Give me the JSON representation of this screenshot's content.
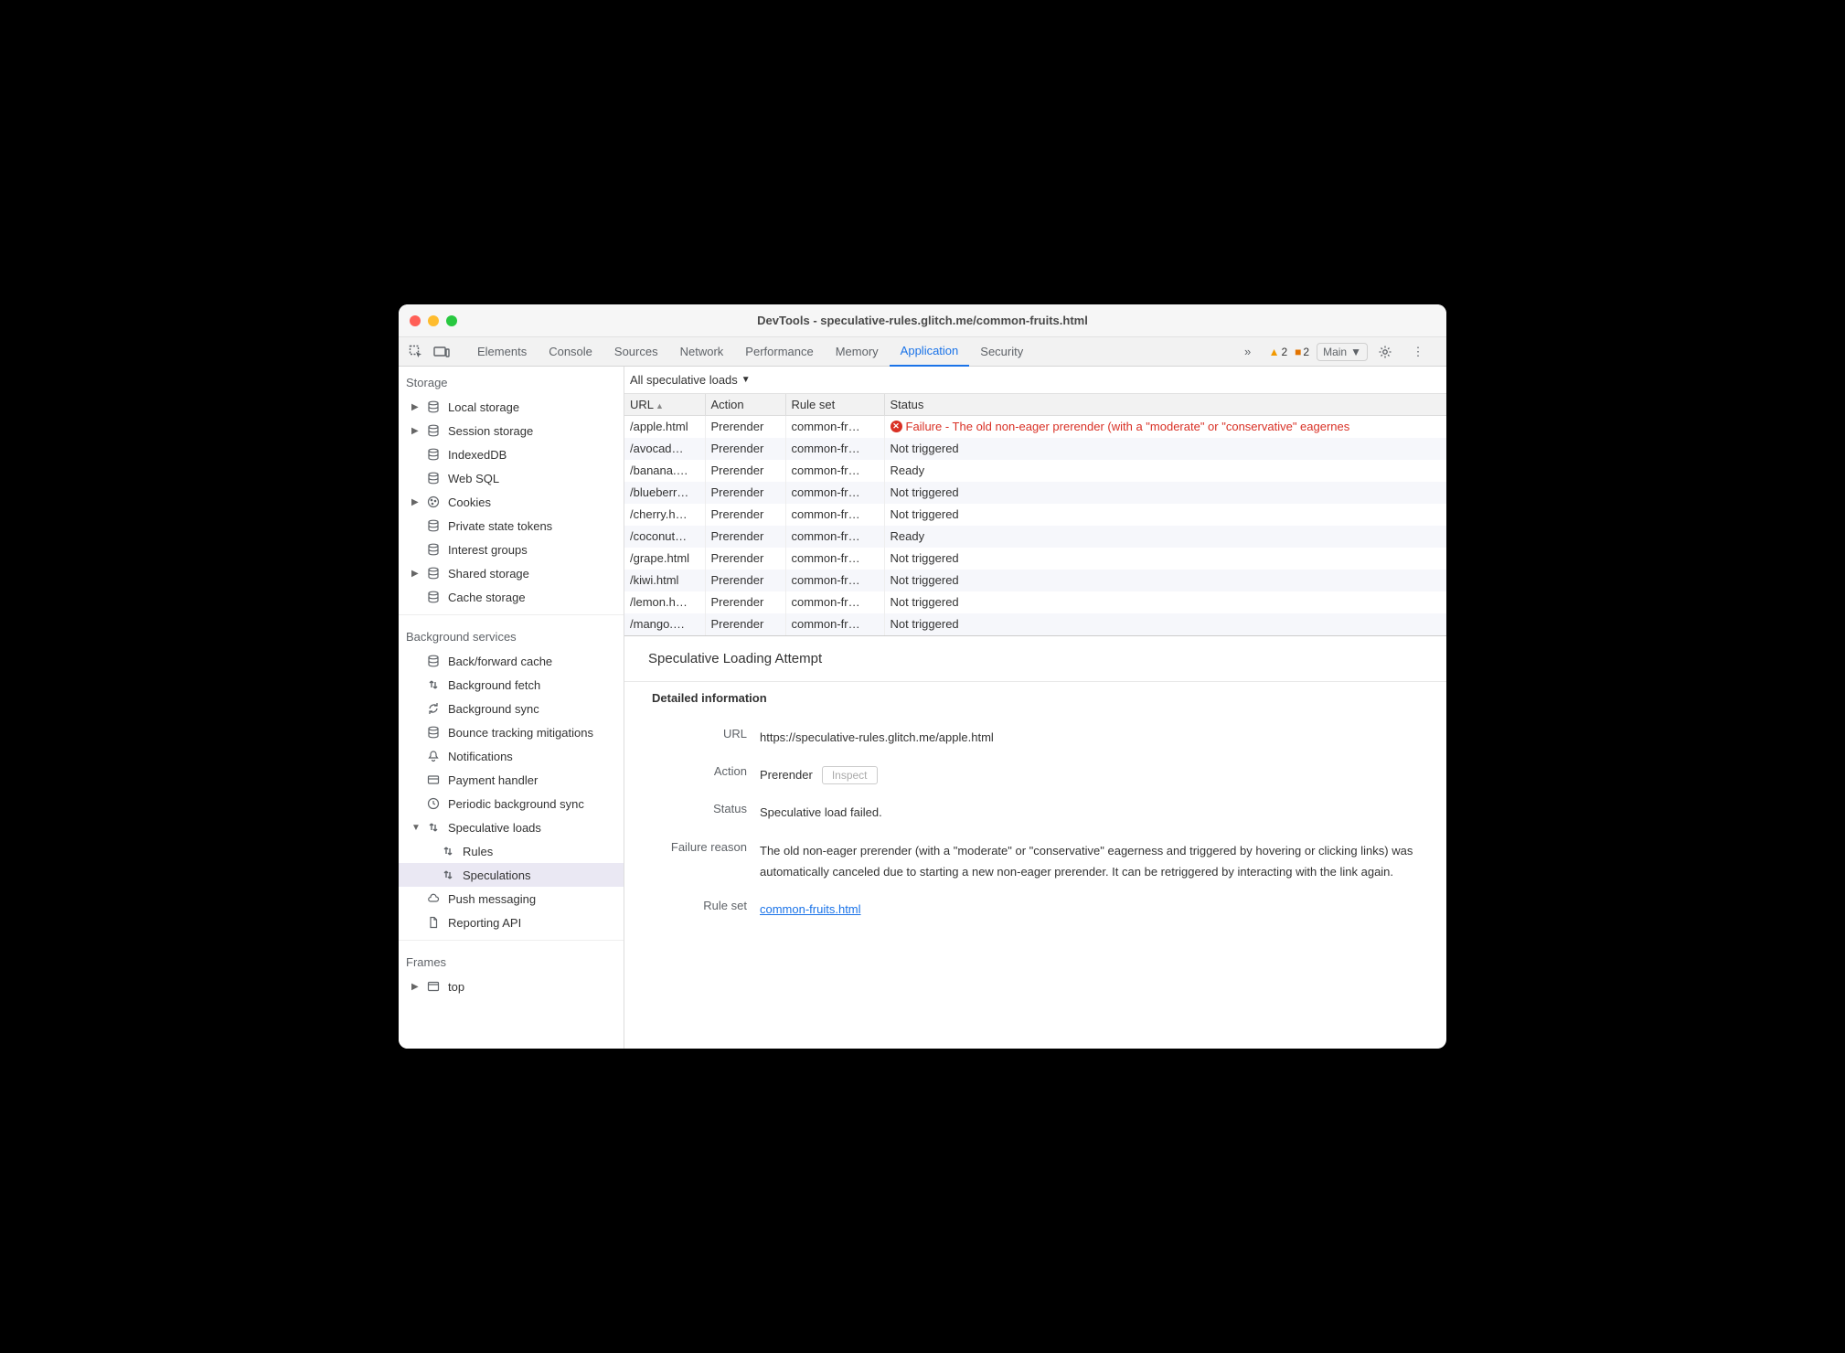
{
  "window": {
    "title": "DevTools - speculative-rules.glitch.me/common-fruits.html"
  },
  "tabs": [
    "Elements",
    "Console",
    "Sources",
    "Network",
    "Performance",
    "Memory",
    "Application",
    "Security"
  ],
  "active_tab": "Application",
  "overflow_indicator": "»",
  "warnings_count": "2",
  "errors_count": "2",
  "target_picker": "Main",
  "sidebar": {
    "storage_title": "Storage",
    "storage_items": [
      {
        "label": "Local storage",
        "icon": "database",
        "caret": true
      },
      {
        "label": "Session storage",
        "icon": "database",
        "caret": true
      },
      {
        "label": "IndexedDB",
        "icon": "database",
        "caret": false
      },
      {
        "label": "Web SQL",
        "icon": "database",
        "caret": false
      },
      {
        "label": "Cookies",
        "icon": "cookie",
        "caret": true
      },
      {
        "label": "Private state tokens",
        "icon": "database",
        "caret": false
      },
      {
        "label": "Interest groups",
        "icon": "database",
        "caret": false
      },
      {
        "label": "Shared storage",
        "icon": "database",
        "caret": true
      },
      {
        "label": "Cache storage",
        "icon": "database",
        "caret": false
      }
    ],
    "bg_title": "Background services",
    "bg_items": [
      {
        "label": "Back/forward cache",
        "icon": "database"
      },
      {
        "label": "Background fetch",
        "icon": "updown"
      },
      {
        "label": "Background sync",
        "icon": "sync"
      },
      {
        "label": "Bounce tracking mitigations",
        "icon": "database"
      },
      {
        "label": "Notifications",
        "icon": "bell"
      },
      {
        "label": "Payment handler",
        "icon": "card"
      },
      {
        "label": "Periodic background sync",
        "icon": "clock"
      },
      {
        "label": "Speculative loads",
        "icon": "updown",
        "caret": "down"
      },
      {
        "label": "Rules",
        "icon": "updown",
        "child": true
      },
      {
        "label": "Speculations",
        "icon": "updown",
        "child": true,
        "selected": true
      },
      {
        "label": "Push messaging",
        "icon": "cloud"
      },
      {
        "label": "Reporting API",
        "icon": "doc"
      }
    ],
    "frames_title": "Frames",
    "frames_items": [
      {
        "label": "top",
        "icon": "frame",
        "caret": true
      }
    ]
  },
  "filter": "All speculative loads",
  "columns": {
    "url": "URL",
    "action": "Action",
    "rule": "Rule set",
    "status": "Status"
  },
  "rows": [
    {
      "url": "/apple.html",
      "action": "Prerender",
      "rule": "common-fr…",
      "status": "Failure - The old non-eager prerender (with a \"moderate\" or \"conservative\" eagernes",
      "fail": true
    },
    {
      "url": "/avocad…",
      "action": "Prerender",
      "rule": "common-fr…",
      "status": "Not triggered"
    },
    {
      "url": "/banana.…",
      "action": "Prerender",
      "rule": "common-fr…",
      "status": "Ready"
    },
    {
      "url": "/blueberr…",
      "action": "Prerender",
      "rule": "common-fr…",
      "status": "Not triggered"
    },
    {
      "url": "/cherry.h…",
      "action": "Prerender",
      "rule": "common-fr…",
      "status": "Not triggered"
    },
    {
      "url": "/coconut…",
      "action": "Prerender",
      "rule": "common-fr…",
      "status": "Ready"
    },
    {
      "url": "/grape.html",
      "action": "Prerender",
      "rule": "common-fr…",
      "status": "Not triggered"
    },
    {
      "url": "/kiwi.html",
      "action": "Prerender",
      "rule": "common-fr…",
      "status": "Not triggered"
    },
    {
      "url": "/lemon.h…",
      "action": "Prerender",
      "rule": "common-fr…",
      "status": "Not triggered"
    },
    {
      "url": "/mango.…",
      "action": "Prerender",
      "rule": "common-fr…",
      "status": "Not triggered"
    }
  ],
  "details": {
    "title": "Speculative Loading Attempt",
    "section": "Detailed information",
    "url_label": "URL",
    "url_value": "https://speculative-rules.glitch.me/apple.html",
    "action_label": "Action",
    "action_value": "Prerender",
    "inspect_label": "Inspect",
    "status_label": "Status",
    "status_value": "Speculative load failed.",
    "reason_label": "Failure reason",
    "reason_value": "The old non-eager prerender (with a \"moderate\" or \"conservative\" eagerness and triggered by hovering or clicking links) was automatically canceled due to starting a new non-eager prerender. It can be retriggered by interacting with the link again.",
    "ruleset_label": "Rule set",
    "ruleset_value": "common-fruits.html"
  }
}
